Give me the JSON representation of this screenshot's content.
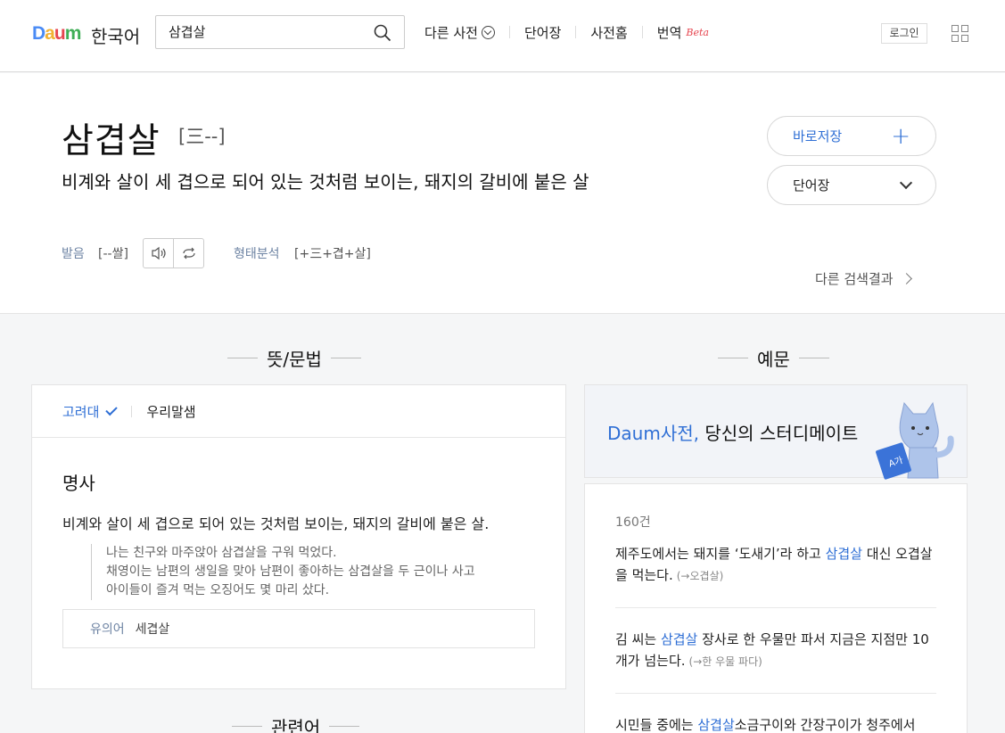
{
  "header": {
    "logo_letters": [
      "D",
      "a",
      "u",
      "m"
    ],
    "lang": "한국어",
    "search_value": "삼겹살",
    "nav": {
      "other_dict": "다른 사전",
      "vocab": "단어장",
      "dict_home": "사전홈",
      "translate": "번역",
      "beta": "Beta"
    },
    "login": "로그인"
  },
  "entry": {
    "word": "삼겹살",
    "hanja": "[三--]",
    "definition": "비계와 살이 세 겹으로 되어 있는 것처럼 보이는, 돼지의 갈비에 붙은 살",
    "pron_label": "발음",
    "pron_value": "[--쌀]",
    "morph_label": "형태분석",
    "morph_value": "[+三+겹+살]",
    "save_button": "바로저장",
    "vocab_button": "단어장",
    "other_results": "다른 검색결과"
  },
  "sections": {
    "meaning": "뜻/문법",
    "examples": "예문",
    "related": "관련어"
  },
  "meaning_panel": {
    "tab_korea_univ": "고려대",
    "tab_urimalsaem": "우리말샘",
    "pos": "명사",
    "sense": "비계와 살이 세 겹으로 되어 있는 것처럼 보이는, 돼지의 갈비에 붙은 살.",
    "examples": [
      "나는 친구와 마주앉아 삼겹살을 구워 먹었다.",
      "채영이는 남편의 생일을 맞아 남편이 좋아하는 삼겹살을 두 근이나 사고",
      "아이들이 즐겨 먹는 오징어도 몇 마리 샀다."
    ],
    "synonym_label": "유의어",
    "synonym_value": "세겹살"
  },
  "banner": {
    "brand": "Daum사전,",
    "tagline": "당신의 스터디메이트"
  },
  "example_panel": {
    "count": "160건",
    "items": [
      {
        "pre": "제주도에서는 돼지를 ‘도새기’라 하고 ",
        "hl": "삼겹살",
        "post": " 대신 오겹살을 먹는다.",
        "src": "(→오겹살)"
      },
      {
        "pre": "김 씨는 ",
        "hl": "삼겹살",
        "post": " 장사로 한 우물만 파서 지금은 지점만 10개가 넘는다.",
        "src": "(→한 우물 파다)"
      },
      {
        "pre": "시민들 중에는 ",
        "hl": "삼겹살",
        "post": "소금구이와 간장구이가 청주에서",
        "src": ""
      }
    ]
  },
  "colors": {
    "accent": "#2f6fd5",
    "label": "#6d83a3",
    "beta": "#e6454f"
  }
}
